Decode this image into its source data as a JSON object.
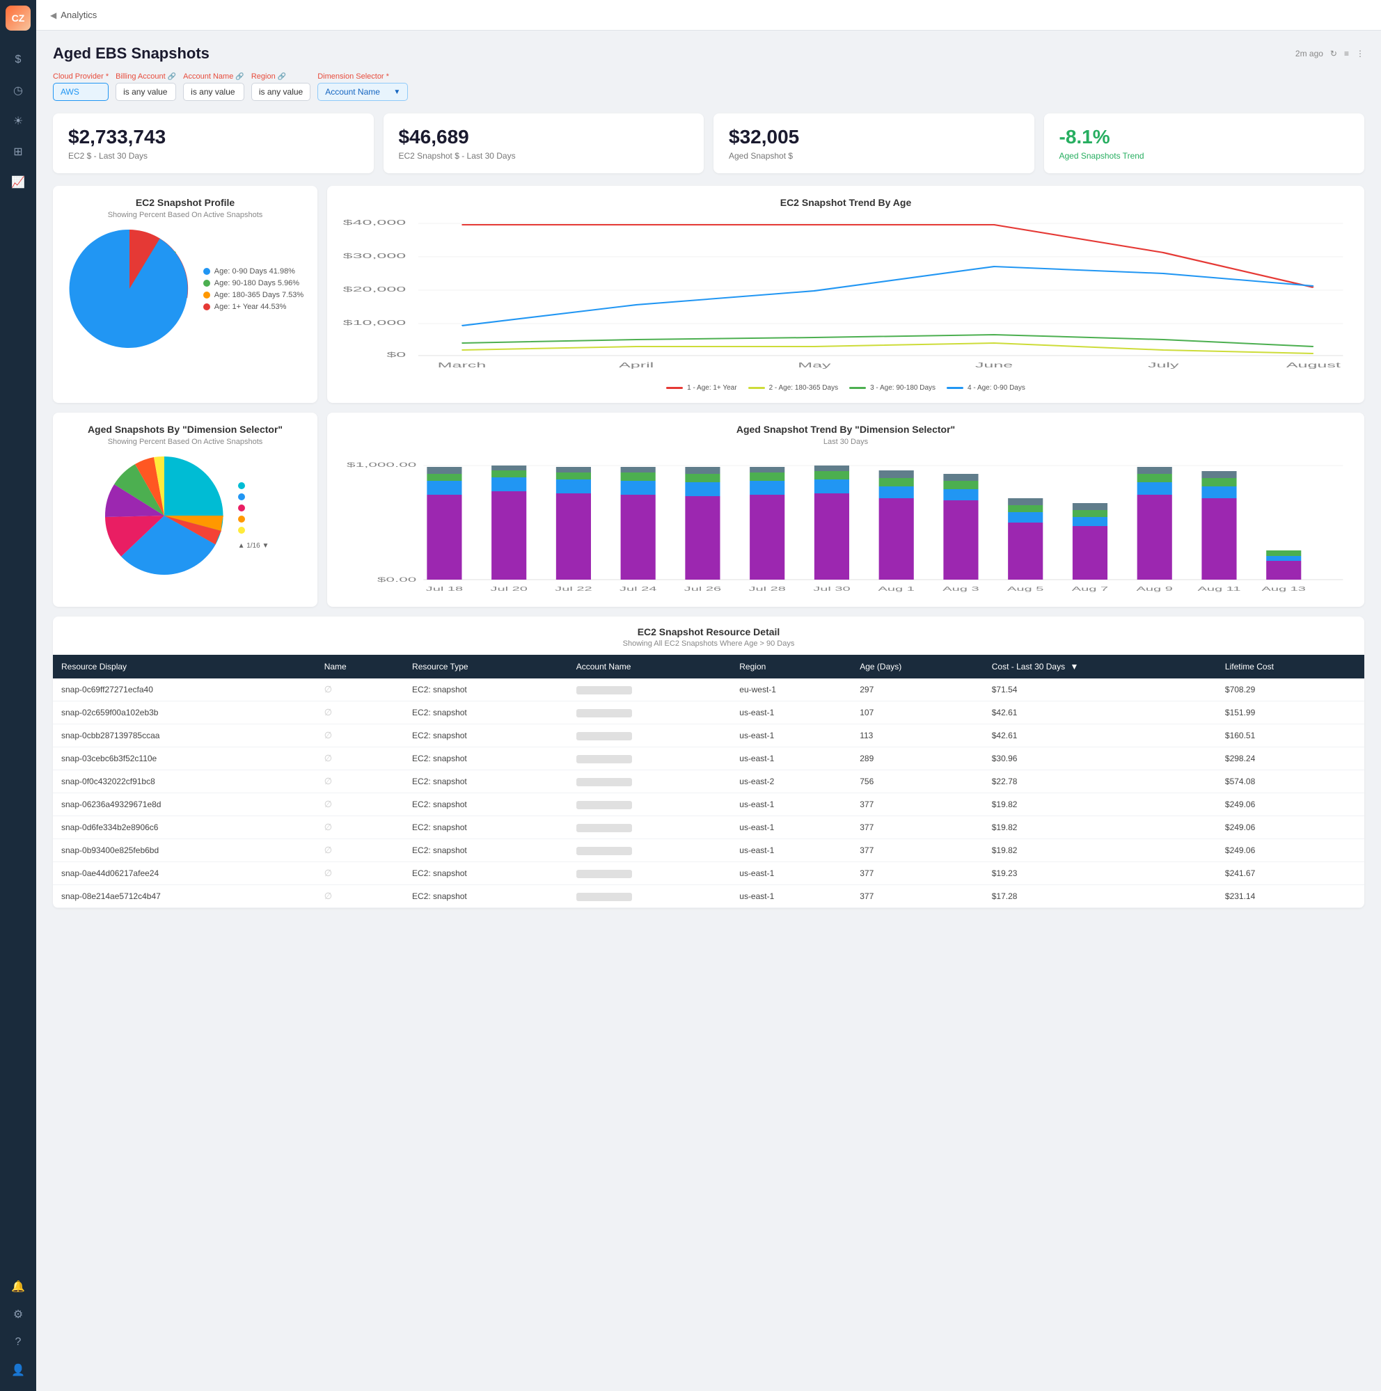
{
  "sidebar": {
    "logo": "CZ",
    "icons": [
      {
        "name": "dollar-icon",
        "symbol": "$",
        "active": false
      },
      {
        "name": "clock-icon",
        "symbol": "◷",
        "active": false
      },
      {
        "name": "bulb-icon",
        "symbol": "💡",
        "active": false
      },
      {
        "name": "grid-icon",
        "symbol": "⊞",
        "active": false
      },
      {
        "name": "chart-icon",
        "symbol": "📊",
        "active": true
      },
      {
        "name": "bell-icon",
        "symbol": "🔔",
        "active": false
      },
      {
        "name": "gear-icon",
        "symbol": "⚙",
        "active": false
      },
      {
        "name": "help-icon",
        "symbol": "?",
        "active": false
      },
      {
        "name": "user-icon",
        "symbol": "👤",
        "active": false
      }
    ]
  },
  "topnav": {
    "back_arrow": "◀",
    "section": "Analytics"
  },
  "page": {
    "title": "Aged EBS Snapshots",
    "last_updated": "2m ago",
    "refresh_icon": "↻",
    "filter_icon": "≡",
    "more_icon": "⋮"
  },
  "filters": {
    "cloud_provider": {
      "label": "Cloud Provider",
      "required": true,
      "value": "AWS"
    },
    "billing_account": {
      "label": "Billing Account",
      "value": "is any value"
    },
    "account_name": {
      "label": "Account Name",
      "value": "is any value"
    },
    "region": {
      "label": "Region",
      "value": "is any value"
    },
    "dimension_selector": {
      "label": "Dimension Selector",
      "required": true,
      "value": "Account Name",
      "arrow": "▼"
    }
  },
  "metrics": [
    {
      "value": "$2,733,743",
      "label": "EC2 $ - Last 30 Days",
      "trend": false
    },
    {
      "value": "$46,689",
      "label": "EC2 Snapshot $ - Last 30 Days",
      "trend": false
    },
    {
      "value": "$32,005",
      "label": "Aged Snapshot $",
      "trend": false
    },
    {
      "value": "-8.1%",
      "label": "Aged Snapshots Trend",
      "trend": true
    }
  ],
  "ec2_snapshot_profile": {
    "title": "EC2 Snapshot Profile",
    "subtitle": "Showing Percent Based On Active Snapshots",
    "legend": [
      {
        "label": "Age: 0-90 Days 41.98%",
        "color": "#2196f3"
      },
      {
        "label": "Age: 90-180 Days 5.96%",
        "color": "#4caf50"
      },
      {
        "label": "Age: 180-365 Days 7.53%",
        "color": "#ff9800"
      },
      {
        "label": "Age: 1+ Year 44.53%",
        "color": "#e53935"
      }
    ]
  },
  "ec2_trend_by_age": {
    "title": "EC2 Snapshot Trend By Age",
    "y_labels": [
      "$40,000",
      "$30,000",
      "$20,000",
      "$10,000",
      "$0"
    ],
    "x_labels": [
      "March",
      "April",
      "May",
      "June",
      "July",
      "August"
    ],
    "legend": [
      {
        "label": "1 - Age: 1+ Year",
        "color": "#e53935"
      },
      {
        "label": "2 - Age: 180-365 Days",
        "color": "#cddc39"
      },
      {
        "label": "3 - Age: 90-180 Days",
        "color": "#4caf50"
      },
      {
        "label": "4 - Age: 0-90 Days",
        "color": "#2196f3"
      }
    ]
  },
  "aged_snapshots_dimension": {
    "title": "Aged Snapshots By \"Dimension Selector\"",
    "subtitle": "Showing Percent Based On Active Snapshots",
    "pagination": "1/16",
    "legend": [
      {
        "color": "#00bcd4"
      },
      {
        "color": "#2196f3"
      },
      {
        "color": "#e91e63"
      },
      {
        "color": "#ff9800"
      },
      {
        "color": "#ffeb3b"
      },
      {
        "color": "#9c27b0"
      },
      {
        "color": "#4caf50"
      },
      {
        "color": "#f44336"
      }
    ]
  },
  "aged_snapshot_trend": {
    "title": "Aged Snapshot Trend By \"Dimension Selector\"",
    "subtitle": "Last 30 Days",
    "y_labels": [
      "$1,000.00",
      "$0.00"
    ],
    "x_labels": [
      "Jul 18",
      "Jul 20",
      "Jul 22",
      "Jul 24",
      "Jul 26",
      "Jul 28",
      "Jul 30",
      "Aug 1",
      "Aug 3",
      "Aug 5",
      "Aug 7",
      "Aug 9",
      "Aug 11",
      "Aug 13"
    ]
  },
  "table": {
    "title": "EC2 Snapshot Resource Detail",
    "subtitle": "Showing All EC2 Snapshots Where Age > 90 Days",
    "columns": [
      "Resource Display",
      "Name",
      "Resource Type",
      "Account Name",
      "Region",
      "Age (Days)",
      "Cost - Last 30 Days",
      "Lifetime Cost"
    ],
    "rows": [
      {
        "resource": "snap-0c69ff27271ecfa40",
        "name": "∅",
        "type": "EC2: snapshot",
        "account": "",
        "region": "eu-west-1",
        "age": "297",
        "cost30": "$71.54",
        "lifetime": "$708.29"
      },
      {
        "resource": "snap-02c659f00a102eb3b",
        "name": "∅",
        "type": "EC2: snapshot",
        "account": "",
        "region": "us-east-1",
        "age": "107",
        "cost30": "$42.61",
        "lifetime": "$151.99"
      },
      {
        "resource": "snap-0cbb287139785ccaa",
        "name": "∅",
        "type": "EC2: snapshot",
        "account": "",
        "region": "us-east-1",
        "age": "113",
        "cost30": "$42.61",
        "lifetime": "$160.51"
      },
      {
        "resource": "snap-03cebc6b3f52c110e",
        "name": "∅",
        "type": "EC2: snapshot",
        "account": "",
        "region": "us-east-1",
        "age": "289",
        "cost30": "$30.96",
        "lifetime": "$298.24"
      },
      {
        "resource": "snap-0f0c432022cf91bc8",
        "name": "∅",
        "type": "EC2: snapshot",
        "account": "",
        "region": "us-east-2",
        "age": "756",
        "cost30": "$22.78",
        "lifetime": "$574.08"
      },
      {
        "resource": "snap-06236a49329671e8d",
        "name": "∅",
        "type": "EC2: snapshot",
        "account": "",
        "region": "us-east-1",
        "age": "377",
        "cost30": "$19.82",
        "lifetime": "$249.06"
      },
      {
        "resource": "snap-0d6fe334b2e8906c6",
        "name": "∅",
        "type": "EC2: snapshot",
        "account": "",
        "region": "us-east-1",
        "age": "377",
        "cost30": "$19.82",
        "lifetime": "$249.06"
      },
      {
        "resource": "snap-0b93400e825feb6bd",
        "name": "∅",
        "type": "EC2: snapshot",
        "account": "",
        "region": "us-east-1",
        "age": "377",
        "cost30": "$19.82",
        "lifetime": "$249.06"
      },
      {
        "resource": "snap-0ae44d06217afee24",
        "name": "∅",
        "type": "EC2: snapshot",
        "account": "",
        "region": "us-east-1",
        "age": "377",
        "cost30": "$19.23",
        "lifetime": "$241.67"
      },
      {
        "resource": "snap-08e214ae5712c4b47",
        "name": "∅",
        "type": "EC2: snapshot",
        "account": "",
        "region": "us-east-1",
        "age": "377",
        "cost30": "$17.28",
        "lifetime": "$231.14"
      }
    ]
  }
}
